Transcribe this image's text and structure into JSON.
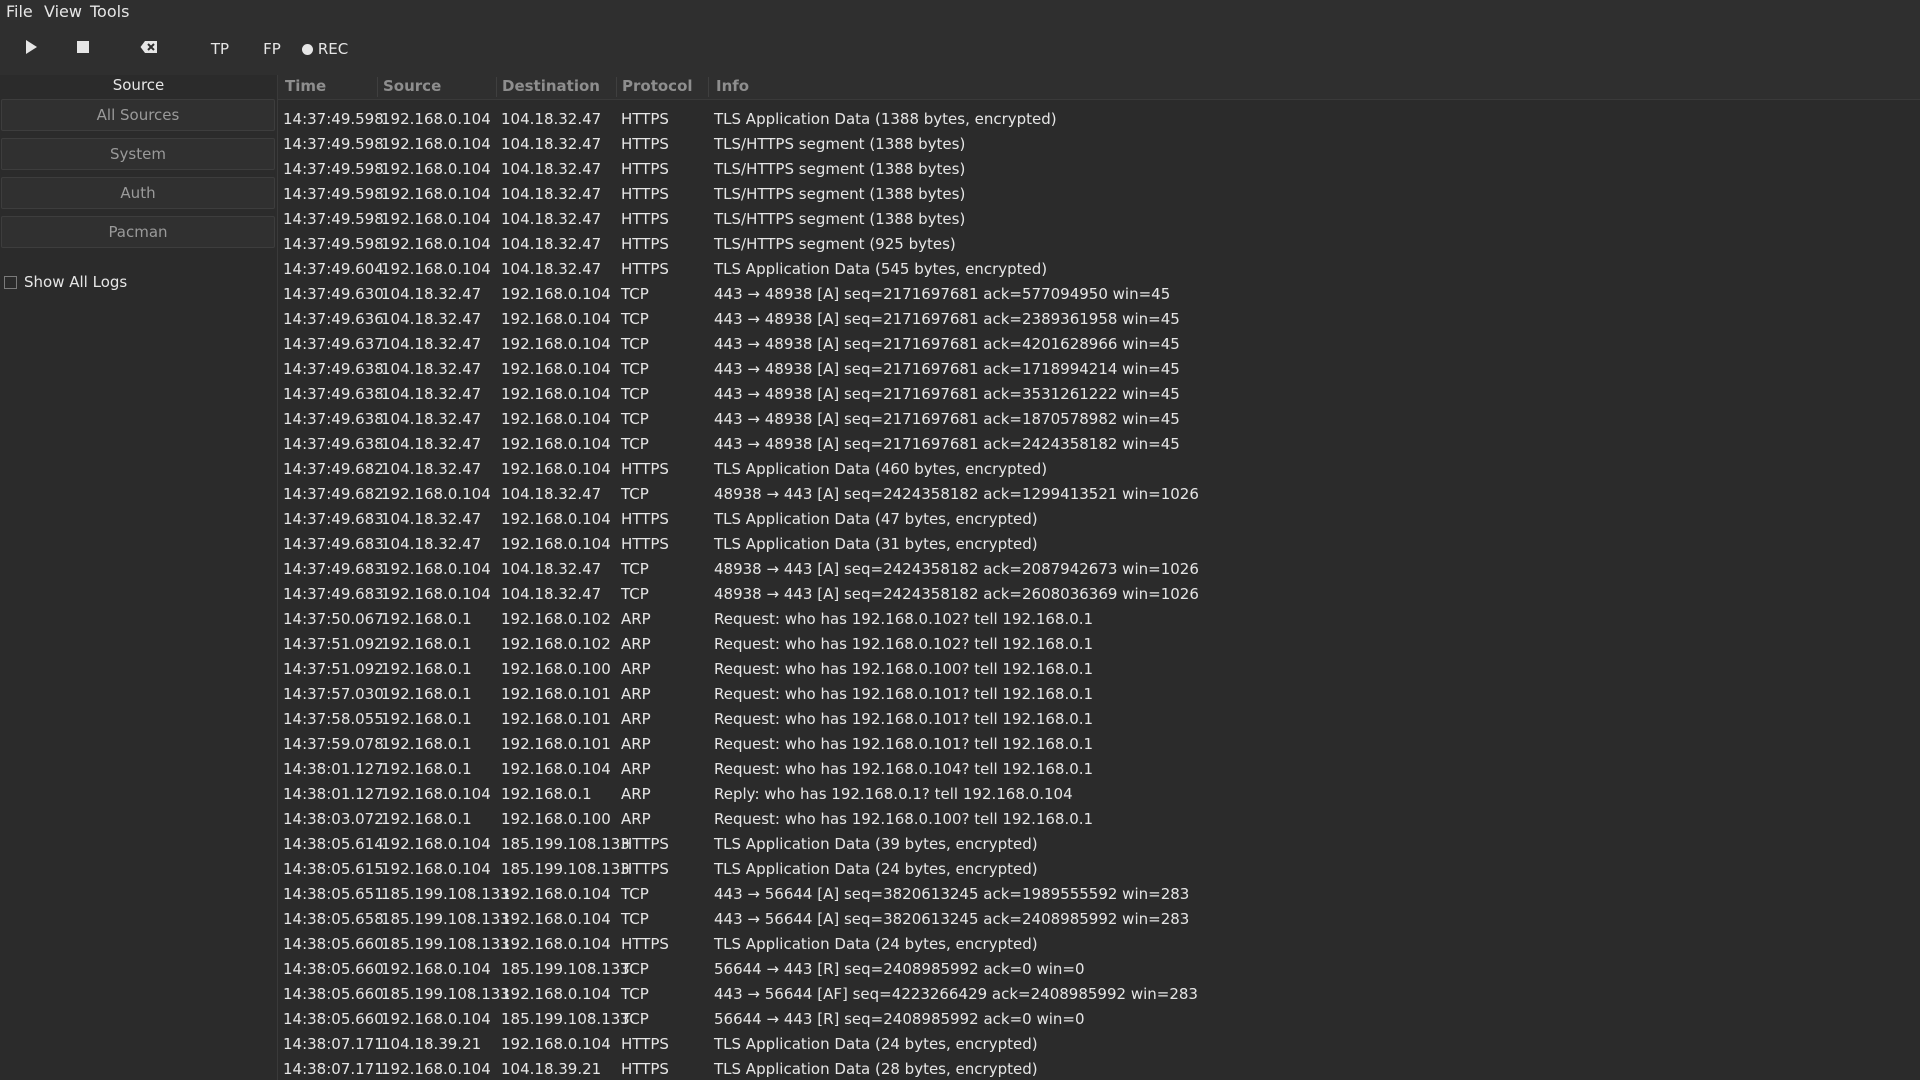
{
  "menu": {
    "file": "File",
    "view": "View",
    "tools": "Tools"
  },
  "toolbar": {
    "play_icon": "play-icon",
    "stop_icon": "stop-icon",
    "clear_icon": "backspace-clear-icon",
    "tp_label": "TP",
    "fp_label": "FP",
    "rec_label": "REC"
  },
  "sidebar": {
    "header": "Source",
    "sources": [
      "All Sources",
      "System",
      "Auth",
      "Pacman"
    ],
    "show_all_logs": "Show All Logs"
  },
  "table": {
    "columns": [
      "Time",
      "Source",
      "Destination",
      "Protocol",
      "Info"
    ],
    "rows": [
      [
        "14:37:49.598",
        "192.168.0.104",
        "104.18.32.47",
        "HTTPS",
        "TLS Application Data (1388 bytes, encrypted)"
      ],
      [
        "14:37:49.598",
        "192.168.0.104",
        "104.18.32.47",
        "HTTPS",
        "TLS/HTTPS segment (1388 bytes)"
      ],
      [
        "14:37:49.598",
        "192.168.0.104",
        "104.18.32.47",
        "HTTPS",
        "TLS/HTTPS segment (1388 bytes)"
      ],
      [
        "14:37:49.598",
        "192.168.0.104",
        "104.18.32.47",
        "HTTPS",
        "TLS/HTTPS segment (1388 bytes)"
      ],
      [
        "14:37:49.598",
        "192.168.0.104",
        "104.18.32.47",
        "HTTPS",
        "TLS/HTTPS segment (1388 bytes)"
      ],
      [
        "14:37:49.598",
        "192.168.0.104",
        "104.18.32.47",
        "HTTPS",
        "TLS/HTTPS segment (925 bytes)"
      ],
      [
        "14:37:49.604",
        "192.168.0.104",
        "104.18.32.47",
        "HTTPS",
        "TLS Application Data (545 bytes, encrypted)"
      ],
      [
        "14:37:49.630",
        "104.18.32.47",
        "192.168.0.104",
        "TCP",
        "443 → 48938 [A] seq=2171697681 ack=577094950 win=45"
      ],
      [
        "14:37:49.636",
        "104.18.32.47",
        "192.168.0.104",
        "TCP",
        "443 → 48938 [A] seq=2171697681 ack=2389361958 win=45"
      ],
      [
        "14:37:49.637",
        "104.18.32.47",
        "192.168.0.104",
        "TCP",
        "443 → 48938 [A] seq=2171697681 ack=4201628966 win=45"
      ],
      [
        "14:37:49.638",
        "104.18.32.47",
        "192.168.0.104",
        "TCP",
        "443 → 48938 [A] seq=2171697681 ack=1718994214 win=45"
      ],
      [
        "14:37:49.638",
        "104.18.32.47",
        "192.168.0.104",
        "TCP",
        "443 → 48938 [A] seq=2171697681 ack=3531261222 win=45"
      ],
      [
        "14:37:49.638",
        "104.18.32.47",
        "192.168.0.104",
        "TCP",
        "443 → 48938 [A] seq=2171697681 ack=1870578982 win=45"
      ],
      [
        "14:37:49.638",
        "104.18.32.47",
        "192.168.0.104",
        "TCP",
        "443 → 48938 [A] seq=2171697681 ack=2424358182 win=45"
      ],
      [
        "14:37:49.682",
        "104.18.32.47",
        "192.168.0.104",
        "HTTPS",
        "TLS Application Data (460 bytes, encrypted)"
      ],
      [
        "14:37:49.682",
        "192.168.0.104",
        "104.18.32.47",
        "TCP",
        "48938 → 443 [A] seq=2424358182 ack=1299413521 win=1026"
      ],
      [
        "14:37:49.683",
        "104.18.32.47",
        "192.168.0.104",
        "HTTPS",
        "TLS Application Data (47 bytes, encrypted)"
      ],
      [
        "14:37:49.683",
        "104.18.32.47",
        "192.168.0.104",
        "HTTPS",
        "TLS Application Data (31 bytes, encrypted)"
      ],
      [
        "14:37:49.683",
        "192.168.0.104",
        "104.18.32.47",
        "TCP",
        "48938 → 443 [A] seq=2424358182 ack=2087942673 win=1026"
      ],
      [
        "14:37:49.683",
        "192.168.0.104",
        "104.18.32.47",
        "TCP",
        "48938 → 443 [A] seq=2424358182 ack=2608036369 win=1026"
      ],
      [
        "14:37:50.067",
        "192.168.0.1",
        "192.168.0.102",
        "ARP",
        "Request: who has 192.168.0.102? tell 192.168.0.1"
      ],
      [
        "14:37:51.092",
        "192.168.0.1",
        "192.168.0.102",
        "ARP",
        "Request: who has 192.168.0.102? tell 192.168.0.1"
      ],
      [
        "14:37:51.092",
        "192.168.0.1",
        "192.168.0.100",
        "ARP",
        "Request: who has 192.168.0.100? tell 192.168.0.1"
      ],
      [
        "14:37:57.030",
        "192.168.0.1",
        "192.168.0.101",
        "ARP",
        "Request: who has 192.168.0.101? tell 192.168.0.1"
      ],
      [
        "14:37:58.055",
        "192.168.0.1",
        "192.168.0.101",
        "ARP",
        "Request: who has 192.168.0.101? tell 192.168.0.1"
      ],
      [
        "14:37:59.078",
        "192.168.0.1",
        "192.168.0.101",
        "ARP",
        "Request: who has 192.168.0.101? tell 192.168.0.1"
      ],
      [
        "14:38:01.127",
        "192.168.0.1",
        "192.168.0.104",
        "ARP",
        "Request: who has 192.168.0.104? tell 192.168.0.1"
      ],
      [
        "14:38:01.127",
        "192.168.0.104",
        "192.168.0.1",
        "ARP",
        "Reply: who has 192.168.0.1? tell 192.168.0.104"
      ],
      [
        "14:38:03.072",
        "192.168.0.1",
        "192.168.0.100",
        "ARP",
        "Request: who has 192.168.0.100? tell 192.168.0.1"
      ],
      [
        "14:38:05.614",
        "192.168.0.104",
        "185.199.108.133",
        "HTTPS",
        "TLS Application Data (39 bytes, encrypted)"
      ],
      [
        "14:38:05.615",
        "192.168.0.104",
        "185.199.108.133",
        "HTTPS",
        "TLS Application Data (24 bytes, encrypted)"
      ],
      [
        "14:38:05.651",
        "185.199.108.133",
        "192.168.0.104",
        "TCP",
        "443 → 56644 [A] seq=3820613245 ack=1989555592 win=283"
      ],
      [
        "14:38:05.658",
        "185.199.108.133",
        "192.168.0.104",
        "TCP",
        "443 → 56644 [A] seq=3820613245 ack=2408985992 win=283"
      ],
      [
        "14:38:05.660",
        "185.199.108.133",
        "192.168.0.104",
        "HTTPS",
        "TLS Application Data (24 bytes, encrypted)"
      ],
      [
        "14:38:05.660",
        "192.168.0.104",
        "185.199.108.133",
        "TCP",
        "56644 → 443 [R] seq=2408985992 ack=0 win=0"
      ],
      [
        "14:38:05.660",
        "185.199.108.133",
        "192.168.0.104",
        "TCP",
        "443 → 56644 [AF] seq=4223266429 ack=2408985992 win=283"
      ],
      [
        "14:38:05.660",
        "192.168.0.104",
        "185.199.108.133",
        "TCP",
        "56644 → 443 [R] seq=2408985992 ack=0 win=0"
      ],
      [
        "14:38:07.171",
        "104.18.39.21",
        "192.168.0.104",
        "HTTPS",
        "TLS Application Data (24 bytes, encrypted)"
      ],
      [
        "14:38:07.171",
        "192.168.0.104",
        "104.18.39.21",
        "HTTPS",
        "TLS Application Data (28 bytes, encrypted)"
      ]
    ]
  }
}
